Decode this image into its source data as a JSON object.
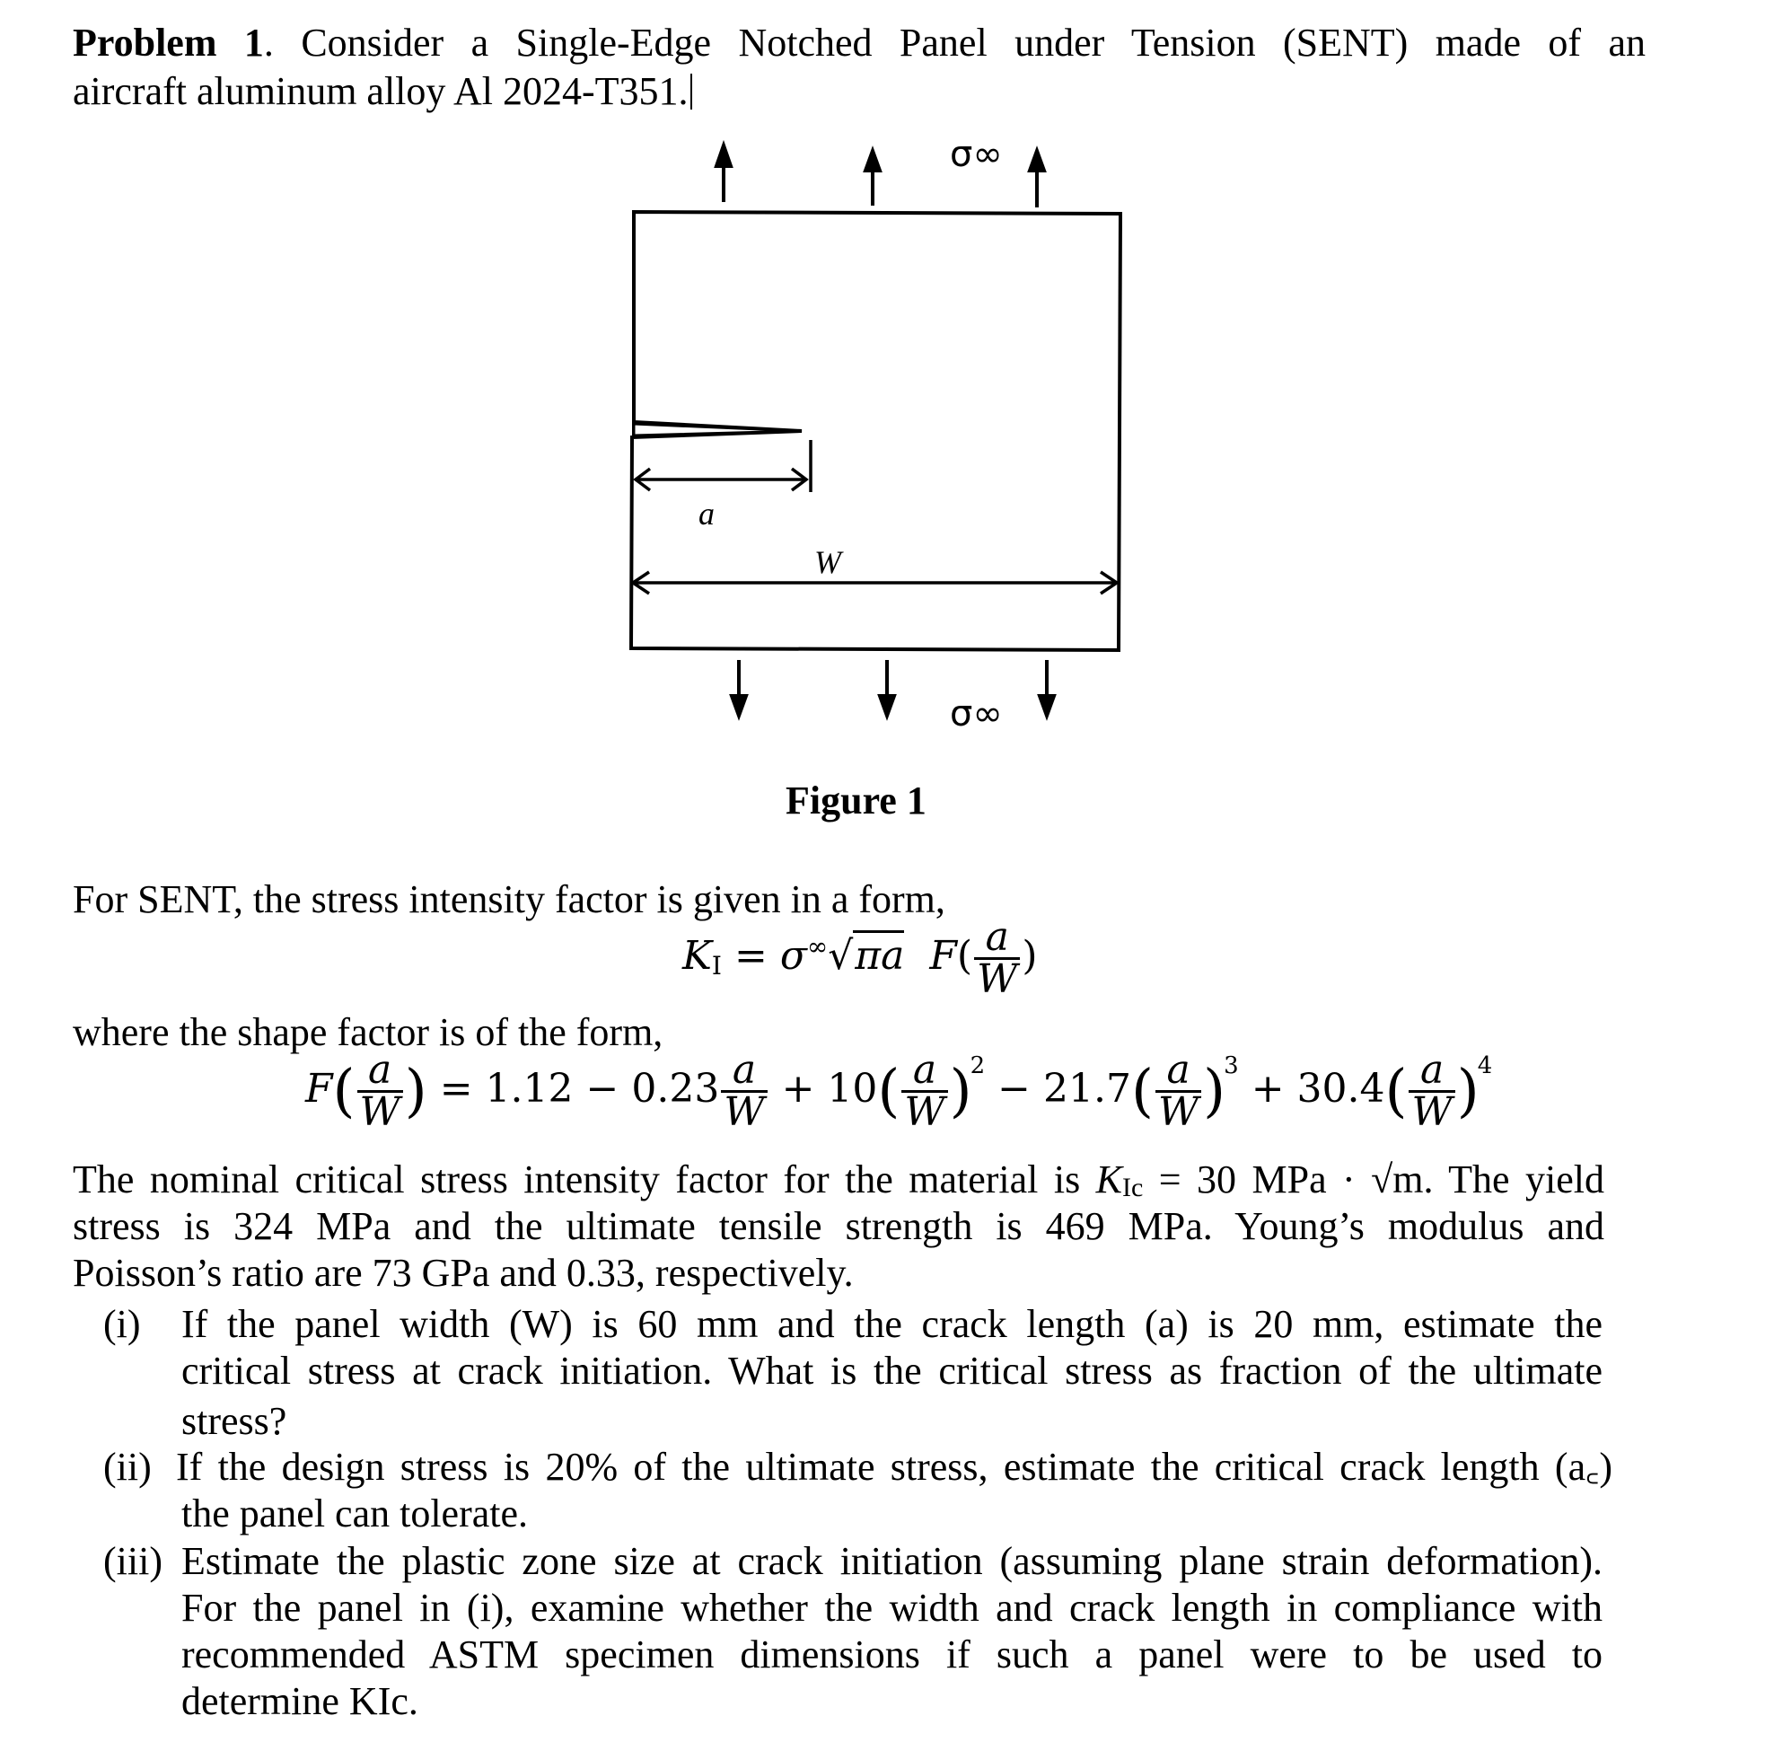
{
  "problem": {
    "heading": "Problem 1",
    "intro_line1_rest": ". Consider a Single-Edge Notched Panel under Tension (SENT) made of an",
    "intro_line2": "aircraft aluminum alloy Al 2024-T351."
  },
  "figure": {
    "caption": "Figure 1",
    "stress_label": "σ∞",
    "crack_label": "a",
    "width_label": "W",
    "load_direction_top": "up",
    "load_direction_bottom": "down"
  },
  "text": {
    "sif_intro": "For SENT, the stress intensity factor is given in a form,",
    "shape_intro": "where the shape factor is of the form,",
    "material_line1_a": "The nominal critical stress intensity factor for the material is ",
    "material_line1_b": " = 30  MPa · √m. The yield",
    "material_line2": "stress is 324 MPa and the ultimate tensile strength is 469 MPa. Young’s modulus and",
    "material_line3": "Poisson’s ratio are 73 GPa and 0.33, respectively."
  },
  "equations": {
    "ki": {
      "lhs": "K",
      "lhs_sub": "I",
      "equals": "=",
      "sigma": "σ",
      "sigma_sup": "∞",
      "sqrt_arg": "πa",
      "func": "F",
      "num": "a",
      "den": "W"
    },
    "shape": {
      "func": "F",
      "num": "a",
      "den": "W",
      "terms": [
        "= 1.12 − 0.23",
        "+ 10",
        "− 21.7",
        "+ 30.4"
      ],
      "powers": [
        "2",
        "3",
        "4"
      ]
    }
  },
  "material": {
    "K_Ic": "30 MPa·√m",
    "yield_stress": "324 MPa",
    "ultimate_tensile_strength": "469 MPa",
    "youngs_modulus": "73 GPa",
    "poissons_ratio": "0.33"
  },
  "questions": [
    {
      "label": "(i)",
      "lines": [
        "If the panel width (W) is 60 mm and the crack length (a) is 20 mm, estimate the",
        "critical stress at crack initiation. What is the critical stress as fraction of the ultimate",
        "stress?"
      ]
    },
    {
      "label": "(ii)",
      "lines": [
        "If the design stress is 20% of the ultimate stress, estimate the critical crack length (a꜀)",
        "the panel can tolerate."
      ]
    },
    {
      "label": "(iii)",
      "lines": [
        "Estimate the plastic zone size at crack initiation (assuming plane strain deformation).",
        "For the panel in (i), examine whether the width and crack length in compliance with",
        "recommended ASTM specimen dimensions if such a panel were to be used to",
        "determine KIc."
      ]
    }
  ],
  "kic_symbol": {
    "base": "K",
    "sub": "Ic"
  }
}
